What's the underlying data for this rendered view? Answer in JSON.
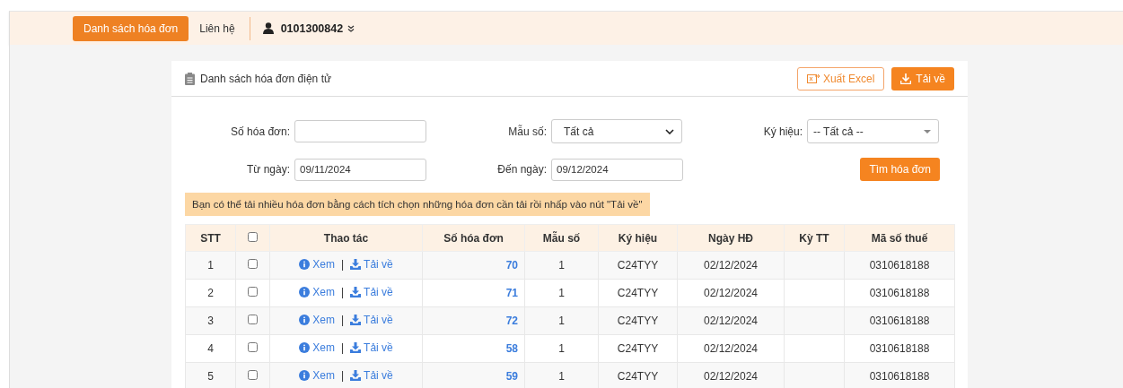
{
  "nav": {
    "items": [
      {
        "label": "Danh sách hóa đơn",
        "selected": true
      },
      {
        "label": "Liên hệ",
        "selected": false
      }
    ],
    "account": "0101300842"
  },
  "card": {
    "title": "Danh sách hóa đơn điện tử",
    "buttons": [
      {
        "label": "Xuất Excel",
        "kind": "outline"
      },
      {
        "label": "Tải về",
        "kind": "solid"
      }
    ]
  },
  "filters": {
    "invoice_no": {
      "label": "Số hóa đơn:"
    },
    "template": {
      "label": "Mẫu số:",
      "value": "Tất cả"
    },
    "symbol": {
      "label": "Ký hiệu:",
      "value": "-- Tất cả --"
    },
    "from_date": {
      "label": "Từ ngày:",
      "value": "09/11/2024"
    },
    "to_date": {
      "label": "Đến ngày:",
      "value": "09/12/2024"
    },
    "search_button": "Tìm hóa đơn"
  },
  "notice": "Bạn có thể tải nhiều hóa đơn bằng cách tích chọn những hóa đơn cần tải rồi nhấp vào nút \"Tải về\"",
  "table": {
    "columns": [
      "STT",
      "Thao tác",
      "Số hóa đơn",
      "Mẫu số",
      "Ký hiệu",
      "Ngày HĐ",
      "Kỳ TT",
      "Mã số thuế"
    ],
    "all_checked": false,
    "rows": [
      {
        "stt": "1",
        "checked": false,
        "view": "Xem",
        "separator": "|",
        "download": "Tải về",
        "invoice_no": "70",
        "template": "1",
        "symbol": "C24TYY",
        "date": "02/12/2024",
        "tax_code": "0310618188"
      },
      {
        "stt": "2",
        "checked": false,
        "view": "Xem",
        "separator": "|",
        "download": "Tải về",
        "invoice_no": "71",
        "template": "1",
        "symbol": "C24TYY",
        "date": "02/12/2024",
        "tax_code": "0310618188"
      },
      {
        "stt": "3",
        "checked": false,
        "view": "Xem",
        "separator": "|",
        "download": "Tải về",
        "invoice_no": "72",
        "template": "1",
        "symbol": "C24TYY",
        "date": "02/12/2024",
        "tax_code": "0310618188"
      },
      {
        "stt": "4",
        "checked": false,
        "view": "Xem",
        "separator": "|",
        "download": "Tải về",
        "invoice_no": "58",
        "template": "1",
        "symbol": "C24TYY",
        "date": "02/12/2024",
        "tax_code": "0310618188"
      },
      {
        "stt": "5",
        "checked": false,
        "view": "Xem",
        "separator": "|",
        "download": "Tải về",
        "invoice_no": "59",
        "template": "1",
        "symbol": "C24TYY",
        "date": "02/12/2024",
        "tax_code": "0310618188"
      }
    ]
  }
}
